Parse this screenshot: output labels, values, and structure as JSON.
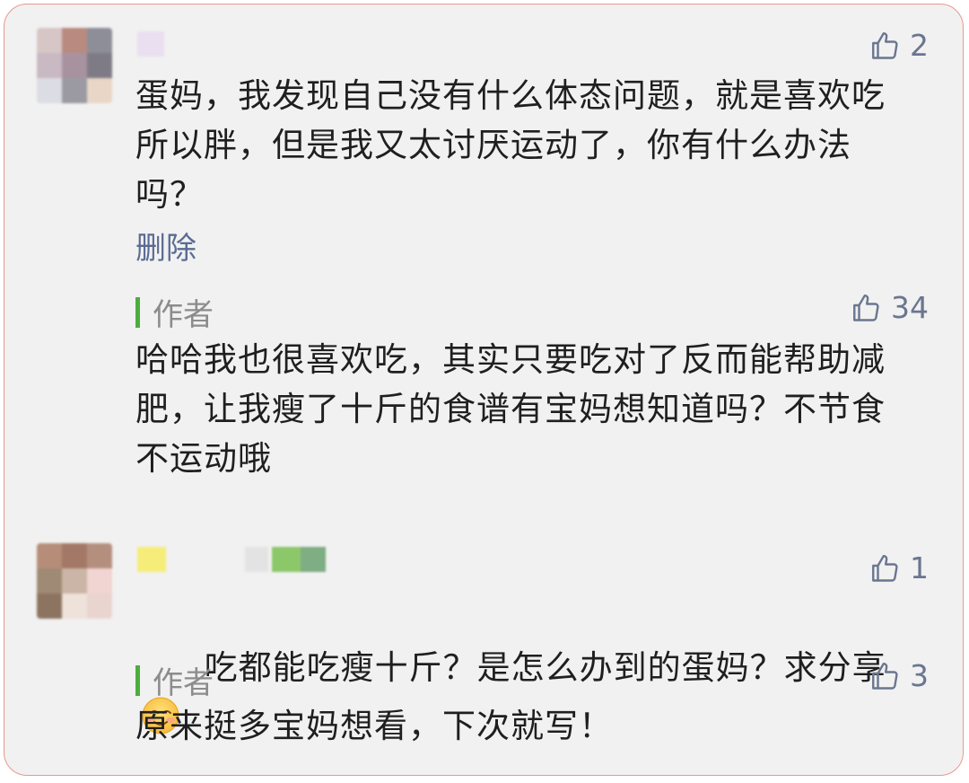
{
  "comments": [
    {
      "likes": "2",
      "text": "蛋妈，我发现自己没有什么体态问题，就是喜欢吃所以胖，但是我又太讨厌运动了，你有什么办法吗？",
      "delete_label": "删除",
      "reply": {
        "author_label": "作者",
        "likes": "34",
        "text": "哈哈我也很喜欢吃，其实只要吃对了反而能帮助减肥，让我瘦了十斤的食谱有宝妈想知道吗？不节食不运动哦"
      }
    },
    {
      "likes": "1",
      "text": "吃都能吃瘦十斤？是怎么办到的蛋妈？求分享",
      "emoji": "smiling-face-emoji",
      "reply": {
        "author_label": "作者",
        "likes": "3",
        "text": "原来挺多宝妈想看，下次就写！"
      }
    }
  ],
  "colors": {
    "accent_green": "#4cae3e",
    "link_blue": "#5b6b94",
    "like_gray": "#6a7690",
    "border": "#e8998c"
  }
}
